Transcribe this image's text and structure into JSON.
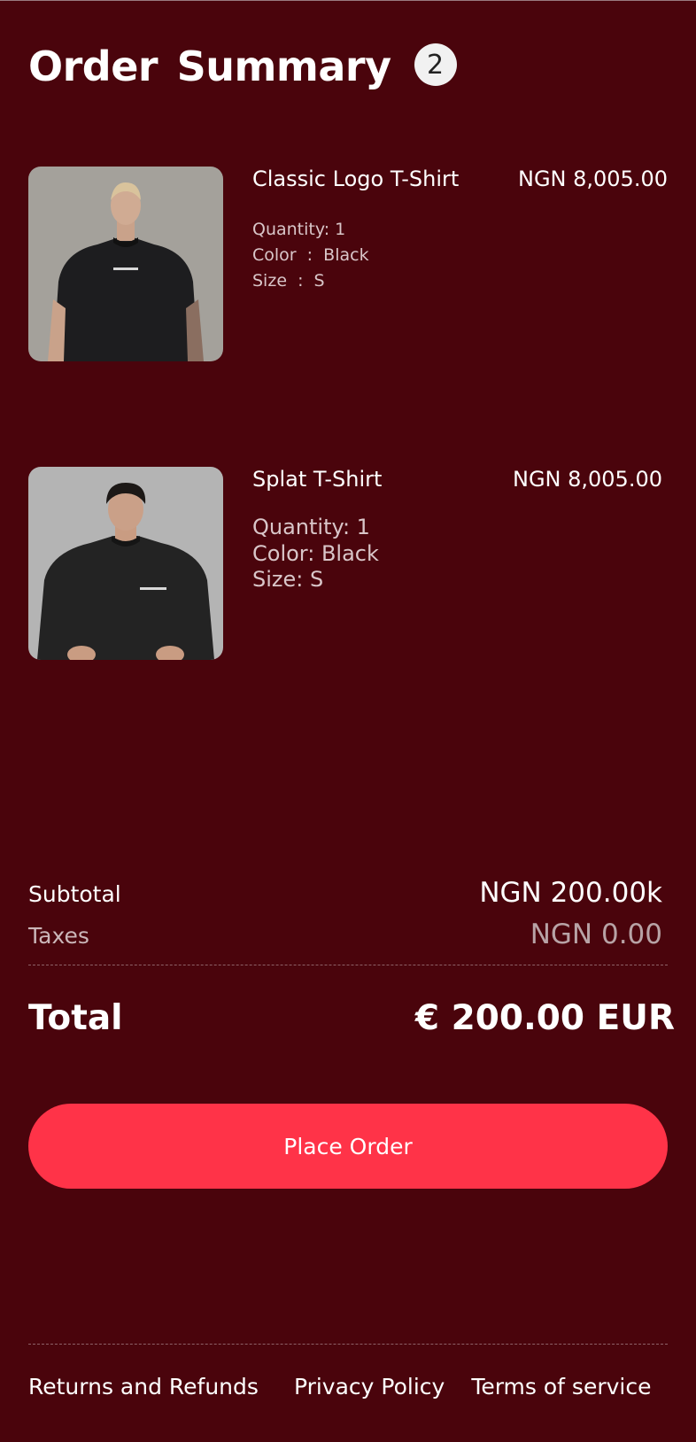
{
  "header": {
    "title": "Order Summary",
    "item_count": "2"
  },
  "items": [
    {
      "name": "Classic Logo T-Shirt",
      "price": "NGN 8,005.00",
      "quantity": "Quantity: 1",
      "color": "Color  :  Black",
      "size": "Size  :  S",
      "image": "product-photo-man-blond-black-tshirt"
    },
    {
      "name": "Splat T-Shirt",
      "price": "NGN 8,005.00",
      "quantity": "Quantity: 1",
      "color": "Color: Black",
      "size": "Size: S",
      "image": "product-photo-man-dark-hair-black-tshirt"
    }
  ],
  "summary": {
    "subtotal_label": "Subtotal",
    "subtotal_value": "NGN 200.00k",
    "taxes_label": "Taxes",
    "taxes_value": "NGN 0.00",
    "total_label": "Total",
    "total_value": "€ 200.00 EUR"
  },
  "actions": {
    "place_order_label": "Place Order"
  },
  "footer": {
    "links": [
      "Returns and Refunds",
      "Privacy Policy",
      "Terms of service"
    ]
  },
  "colors": {
    "background": "#4a040c",
    "accent": "#ff3348",
    "badge": "#f1f1f1"
  }
}
